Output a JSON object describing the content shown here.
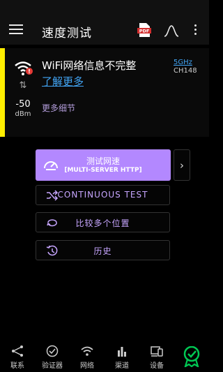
{
  "app_bar": {
    "title": "速度测试",
    "pdf_label": "PDF"
  },
  "wifi_info": {
    "title": "WiFi网络信息不完整",
    "learn_more": "了解更多",
    "more_details": "更多细节",
    "signal_value": "-50",
    "signal_unit": "dBm",
    "band": "5GHz",
    "channel": "CH148",
    "accent_color": "#ffee00"
  },
  "actions": {
    "speed_test_label": "测试网速",
    "speed_test_sub": "[MULTI-SERVER HTTP]",
    "continuous_label": "CONTINUOUS TEST",
    "compare_label": "比较多个位置",
    "history_label": "历史",
    "accent_color": "#b388ff"
  },
  "bottom_nav": {
    "items": [
      {
        "label": "联系",
        "icon": "share-nodes-icon"
      },
      {
        "label": "验证器",
        "icon": "check-circle-icon"
      },
      {
        "label": "网络",
        "icon": "wifi-icon"
      },
      {
        "label": "渠道",
        "icon": "bar-chart-icon"
      },
      {
        "label": "设备",
        "icon": "devices-icon"
      }
    ],
    "badge_icon": "verified-badge-icon",
    "badge_color": "#00c853"
  }
}
